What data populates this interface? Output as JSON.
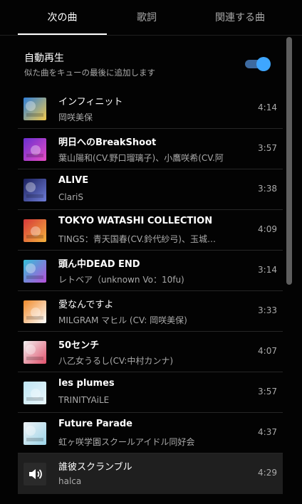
{
  "tabs": [
    {
      "label": "次の曲",
      "active": true
    },
    {
      "label": "歌詞",
      "active": false
    },
    {
      "label": "関連する曲",
      "active": false
    }
  ],
  "autoplay": {
    "title": "自動再生",
    "subtitle": "似た曲をキューの最後に追加します",
    "enabled": true
  },
  "queue": [
    {
      "title": "インフィニット",
      "artist": "岡咲美保",
      "duration": "4:14",
      "thumb_icon": "album-art-infinite",
      "thumb_colors": [
        "#2f7fd9",
        "#f2c94c"
      ]
    },
    {
      "title": "明日へのBreakShoot",
      "artist": "葉山陽和(CV.野口瑠璃子)、小鷹咲希(CV.阿",
      "duration": "3:57",
      "thumb_icon": "album-art-breakshoot",
      "thumb_colors": [
        "#6a2fd1",
        "#e74cc4"
      ]
    },
    {
      "title": "ALIVE",
      "artist": "ClariS",
      "duration": "3:38",
      "thumb_icon": "album-art-alive",
      "thumb_colors": [
        "#1a1f5c",
        "#6f7dd8"
      ]
    },
    {
      "title": "TOKYO WATASHI COLLECTION",
      "artist": "TINGS：青天国春(CV.鈴代紗弓)、玉城…",
      "duration": "4:09",
      "thumb_icon": "album-art-tokyo-watashi",
      "thumb_colors": [
        "#d6383a",
        "#f4b23c"
      ]
    },
    {
      "title": "頭ん中DEAD END",
      "artist": "レトベア（unknown Vo：10fu)",
      "duration": "3:14",
      "thumb_icon": "album-art-dead-end",
      "thumb_colors": [
        "#33c1d9",
        "#b64fd9"
      ]
    },
    {
      "title": "愛なんですよ",
      "artist": "MILGRAM マヒル (CV: 岡咲美保)",
      "duration": "3:33",
      "thumb_icon": "album-art-ai-nandesuyo",
      "thumb_colors": [
        "#f08a2a",
        "#ffffff"
      ]
    },
    {
      "title": "50センチ",
      "artist": "八乙女うるし(CV:中村カンナ)",
      "duration": "4:07",
      "thumb_icon": "album-art-50cm",
      "thumb_colors": [
        "#f2f2f2",
        "#e0506b"
      ]
    },
    {
      "title": "les plumes",
      "artist": "TRINITYAiLE",
      "duration": "3:57",
      "thumb_icon": "album-art-les-plumes",
      "thumb_colors": [
        "#bfe6f5",
        "#e9f6fb"
      ]
    },
    {
      "title": "Future Parade",
      "artist": "虹ヶ咲学園スクールアイドル同好会",
      "duration": "4:37",
      "thumb_icon": "album-art-future-parade",
      "thumb_colors": [
        "#eef2f5",
        "#9bd4e8"
      ]
    },
    {
      "title": "誰彼スクランブル",
      "artist": "halca",
      "duration": "4:29",
      "thumb_icon": "now-playing-speaker-icon",
      "thumb_colors": [
        "#2a2a2a",
        "#ffffff"
      ],
      "playing": true
    }
  ]
}
